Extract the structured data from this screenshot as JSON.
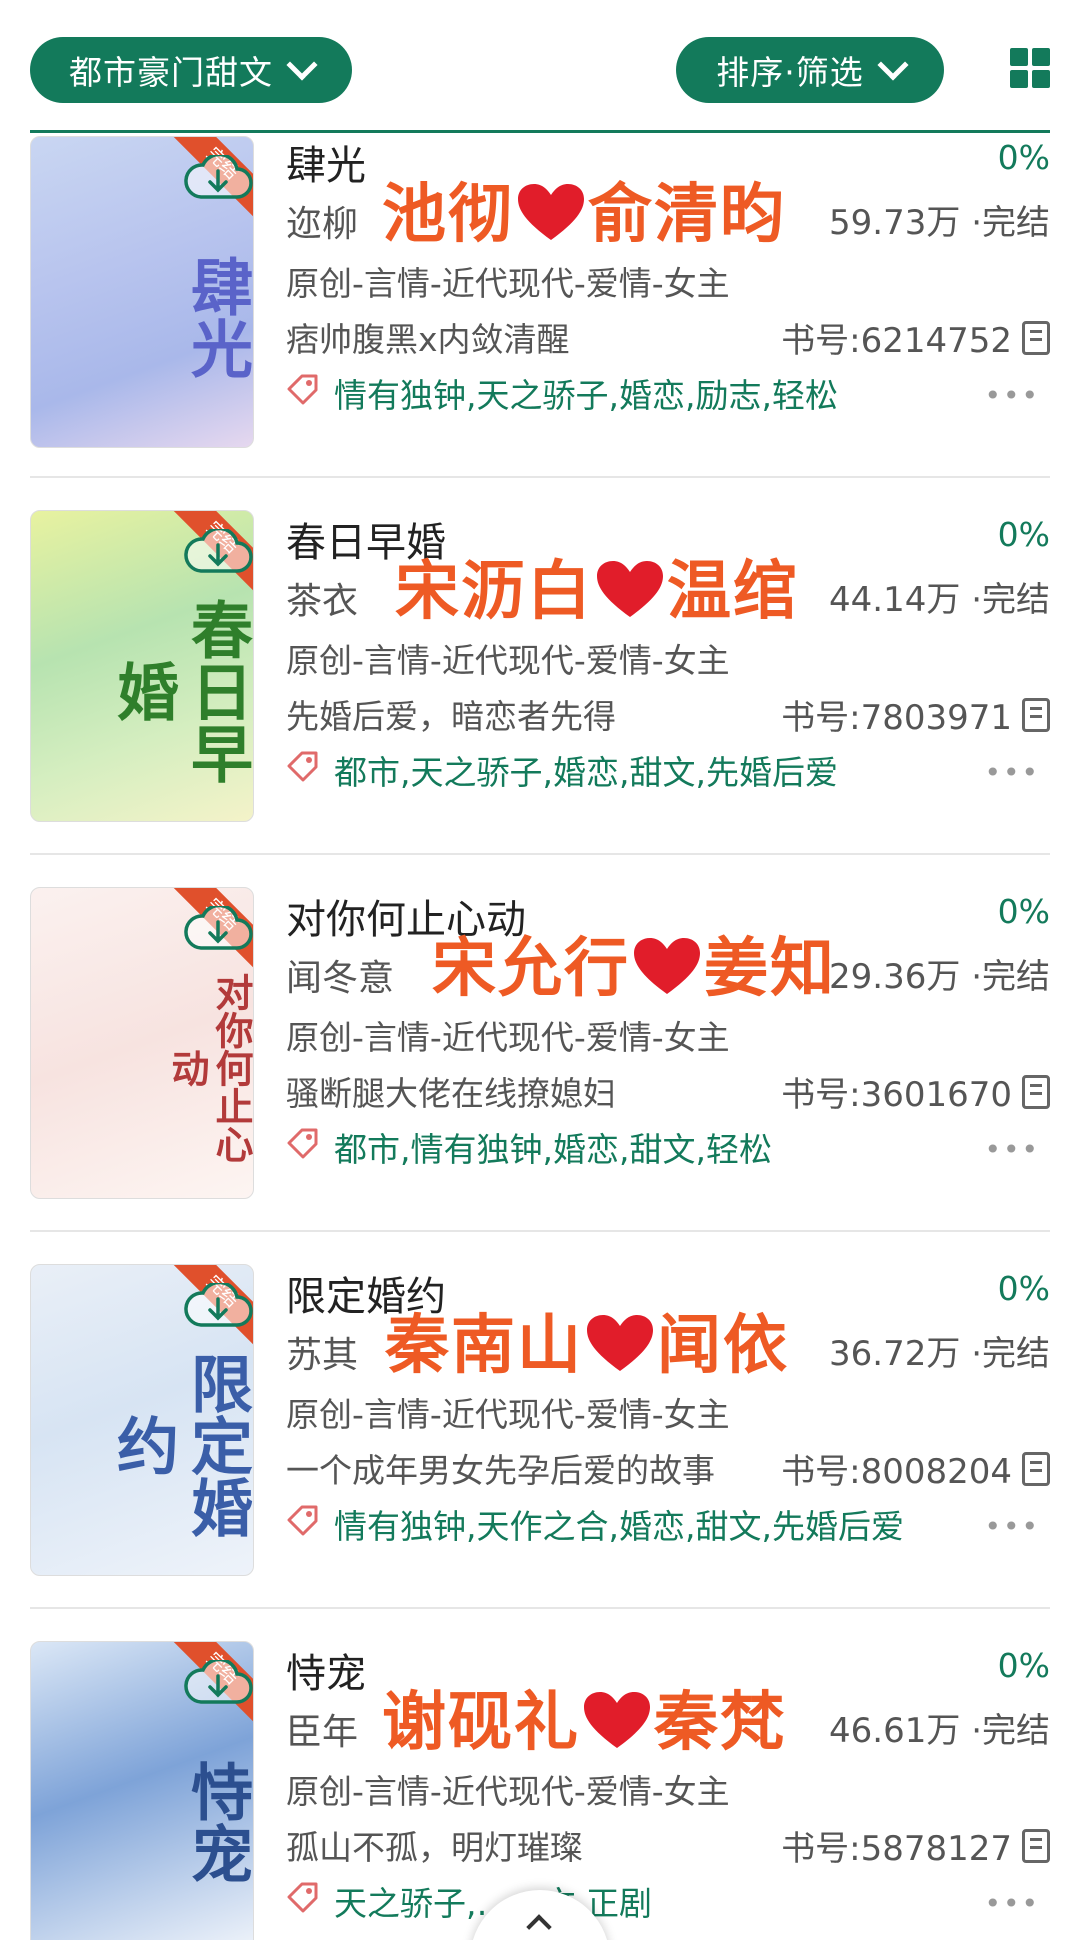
{
  "header": {
    "category_label": "都市豪门甜文",
    "sort_label": "排序·筛选",
    "grid_icon": "grid-view-icon"
  },
  "colors": {
    "accent": "#137a5b",
    "overlay_text": "#ee5a24",
    "heart": "#e11d2a"
  },
  "books": [
    {
      "title": "肆光",
      "author": "迩柳",
      "overlay_left": "池彻",
      "overlay_right": "俞清昀",
      "progress": "0%",
      "words": "59.73万 ·完结",
      "category": "原创-言情-近代现代-爱情-女主",
      "intro": "痞帅腹黑x内敛清醒",
      "book_no": "书号:6214752",
      "tags": "情有独钟,天之骄子,婚恋,励志,轻松",
      "cover_badge": "完结",
      "cover_text": "肆光",
      "cover_bg": "linear-gradient(160deg,#c9d6f2 0%,#b8c4ee 40%,#a9b8ea 70%,#e6d8ef 100%)",
      "cover_color": "#5a63c9"
    },
    {
      "title": "春日早婚",
      "author": "茶衣",
      "overlay_left": "宋沥白",
      "overlay_right": "温绾",
      "progress": "0%",
      "words": "44.14万 ·完结",
      "category": "原创-言情-近代现代-爱情-女主",
      "intro": "先婚后爱，暗恋者先得",
      "book_no": "书号:7803971",
      "tags": "都市,天之骄子,婚恋,甜文,先婚后爱",
      "cover_badge": "完结",
      "cover_text": "春日早婚",
      "cover_bg": "linear-gradient(160deg,#e8f2a0 0%,#b7e3b0 40%,#d5eec0 70%,#f4f3c9 100%)",
      "cover_color": "#2f7f2b"
    },
    {
      "title": "对你何止心动",
      "author": "闻冬意",
      "overlay_left": "宋允行",
      "overlay_right": "姜知",
      "progress": "0%",
      "words": "29.36万 ·完结",
      "category": "原创-言情-近代现代-爱情-女主",
      "intro": "骚断腿大佬在线撩媳妇",
      "book_no": "书号:3601670",
      "tags": "都市,情有独钟,婚恋,甜文,轻松",
      "cover_badge": "完结",
      "cover_text": "对你何止心动",
      "cover_bg": "linear-gradient(160deg,#fbf1ef 0%,#f7e3e0 50%,#fdf5f2 100%)",
      "cover_color": "#b23a3a"
    },
    {
      "title": "限定婚约",
      "author": "苏其",
      "overlay_left": "秦南山",
      "overlay_right": "闻依",
      "progress": "0%",
      "words": "36.72万 ·完结",
      "category": "原创-言情-近代现代-爱情-女主",
      "intro": "一个成年男女先孕后爱的故事",
      "book_no": "书号:8008204",
      "tags": "情有独钟,天作之合,婚恋,甜文,先婚后爱",
      "cover_badge": "完结",
      "cover_text": "限定婚约",
      "cover_bg": "linear-gradient(160deg,#e9eff7 0%,#d7e4f3 45%,#eef3fa 100%)",
      "cover_color": "#3a5ea8"
    },
    {
      "title": "恃宠",
      "author": "臣年",
      "overlay_left": "谢砚礼",
      "overlay_right": "秦梵",
      "progress": "0%",
      "words": "46.61万 ·完结",
      "category": "原创-言情-近代现代-爱情-女主",
      "intro": "孤山不孤，明灯璀璨",
      "book_no": "书号:5878127",
      "tags": "天之骄子,……文,正剧",
      "cover_badge": "完结",
      "cover_text": "恃宠",
      "cover_bg": "linear-gradient(160deg,#dbe7f6 0%,#7ea3d8 45%,#f1f5fb 100%)",
      "cover_color": "#2c4f8f"
    }
  ]
}
